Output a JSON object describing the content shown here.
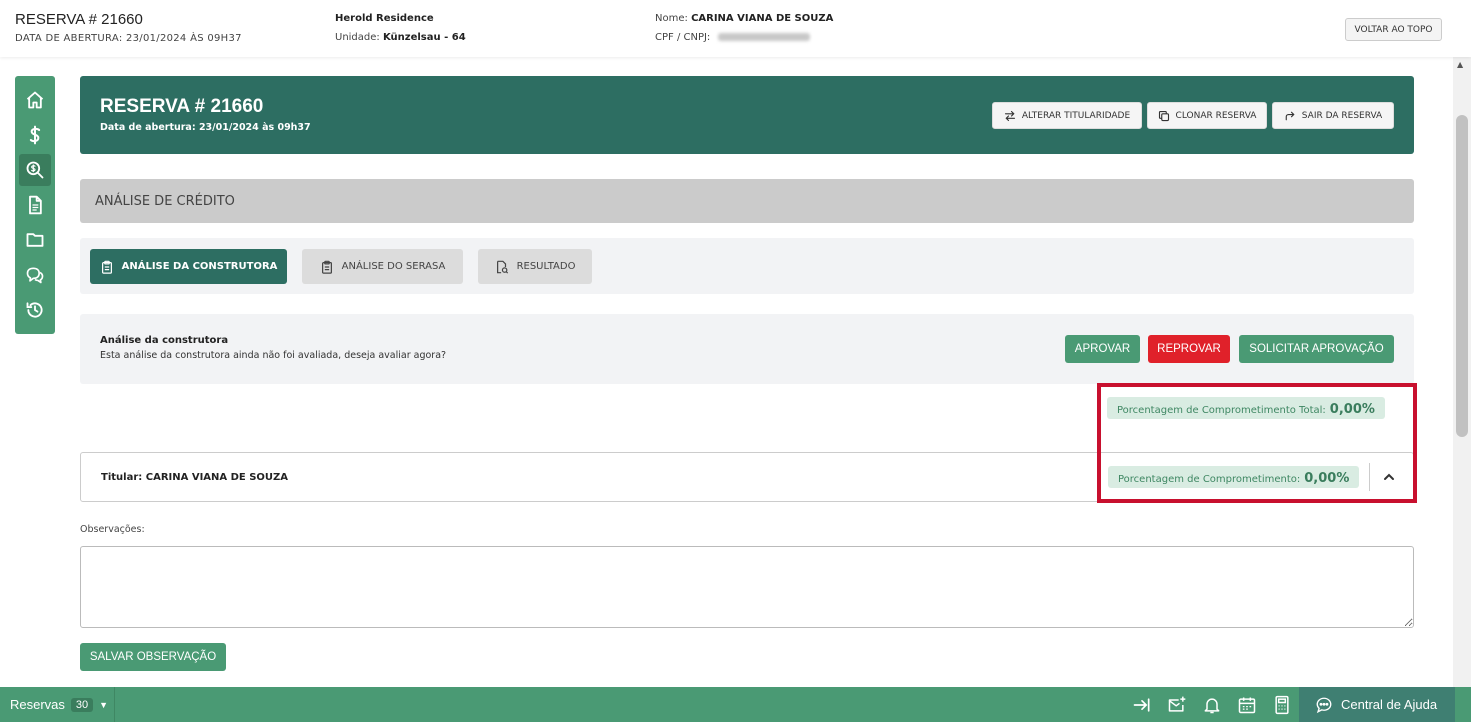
{
  "topbar": {
    "title": "RESERVA # 21660",
    "opening_date": "DATA DE ABERTURA: 23/01/2024 ÀS 09H37",
    "enterprise": "Herold Residence",
    "unit_label": "Unidade:",
    "unit_value": "Künzelsau - 64",
    "name_label": "Nome:",
    "name_value": "CARINA VIANA DE SOUZA",
    "cpf_label": "CPF / CNPJ:",
    "back_to_top": "VOLTAR AO TOPO"
  },
  "sidebar": {
    "items": [
      {
        "icon": "home-icon"
      },
      {
        "icon": "dollar-icon"
      },
      {
        "icon": "search-money-icon",
        "active": true
      },
      {
        "icon": "document-icon"
      },
      {
        "icon": "folder-icon"
      },
      {
        "icon": "chat-icon"
      },
      {
        "icon": "history-icon"
      }
    ]
  },
  "header": {
    "title": "RESERVA # 21660",
    "opening_date": "Data de abertura: 23/01/2024 às 09h37",
    "buttons": {
      "transfer": "ALTERAR TITULARIDADE",
      "clone": "CLONAR RESERVA",
      "exit": "SAIR DA RESERVA"
    }
  },
  "section": {
    "title": "ANÁLISE DE CRÉDITO"
  },
  "tabs": {
    "builder": "ANÁLISE DA CONSTRUTORA",
    "serasa": "ANÁLISE DO SERASA",
    "result": "RESULTADO"
  },
  "analysis": {
    "title": "Análise da construtora",
    "description": "Esta análise da construtora ainda não foi avaliada, deseja avaliar agora?",
    "approve": "APROVAR",
    "reject": "REPROVAR",
    "request_approval": "SOLICITAR APROVAÇÃO"
  },
  "commitment": {
    "total_label": "Porcentagem de Comprometimento Total:",
    "total_value": "0,00%",
    "holder_label": "Porcentagem de Comprometimento:",
    "holder_value": "0,00%"
  },
  "titular": {
    "label": "Titular: CARINA VIANA DE SOUZA"
  },
  "observations": {
    "label": "Observações:",
    "value": "",
    "save": "SALVAR OBSERVAÇÃO"
  },
  "bottombar": {
    "reservas_label": "Reservas",
    "reservas_count": "30",
    "help": "Central de Ajuda"
  },
  "colors": {
    "primary_dark": "#2d6e62",
    "primary": "#4a9a74",
    "danger": "#e0212a",
    "highlight": "#c8102e"
  }
}
